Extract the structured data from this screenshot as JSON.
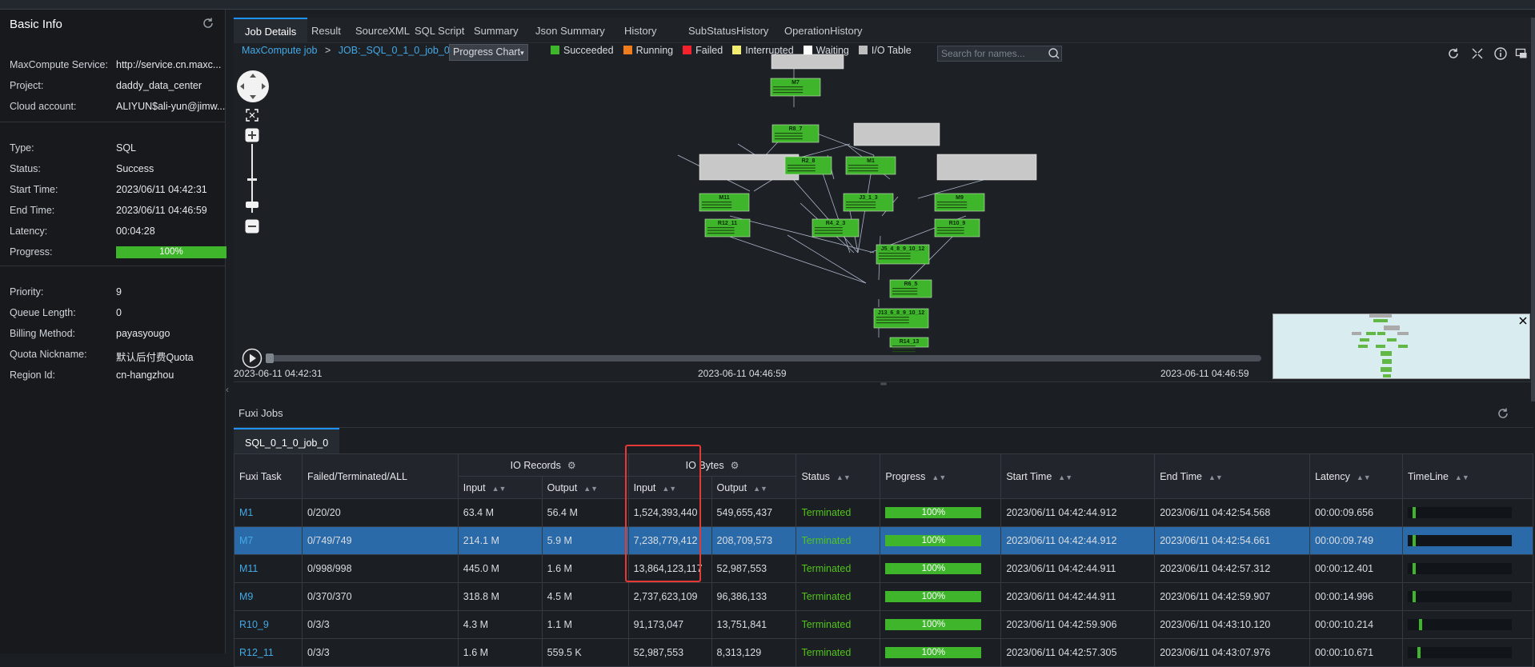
{
  "basic_info": {
    "title": "Basic Info",
    "fields": [
      {
        "label": "MaxCompute Service:",
        "value": "http://service.cn.maxc..."
      },
      {
        "label": "Project:",
        "value": "daddy_data_center"
      },
      {
        "label": "Cloud account:",
        "value": "ALIYUN$ali-yun@jimw..."
      },
      {
        "label": "Type:",
        "value": "SQL"
      },
      {
        "label": "Status:",
        "value": "Success"
      },
      {
        "label": "Start Time:",
        "value": "2023/06/11 04:42:31"
      },
      {
        "label": "End Time:",
        "value": "2023/06/11 04:46:59"
      },
      {
        "label": "Latency:",
        "value": "00:04:28"
      },
      {
        "label": "Progress:",
        "value": "100%"
      },
      {
        "label": "Priority:",
        "value": "9"
      },
      {
        "label": "Queue Length:",
        "value": "0"
      },
      {
        "label": "Billing Method:",
        "value": "payasyougo"
      },
      {
        "label": "Quota Nickname:",
        "value": "默认后付费Quota"
      },
      {
        "label": "Region Id:",
        "value": "cn-hangzhou"
      }
    ]
  },
  "tabs": [
    "Job Details",
    "Result",
    "SourceXML",
    "SQL Script",
    "Summary",
    "Json Summary",
    "History",
    "SubStatusHistory",
    "OperationHistory"
  ],
  "graph": {
    "breadcrumb": [
      "MaxCompute job",
      ">",
      "JOB:_SQL_0_1_0_job_0"
    ],
    "view_select": "Progress Chart",
    "legend": [
      {
        "label": "Succeeded",
        "color": "#3fb52c"
      },
      {
        "label": "Running",
        "color": "#f07c1e"
      },
      {
        "label": "Failed",
        "color": "#f5222d"
      },
      {
        "label": "Interrupted",
        "color": "#f2ee72"
      },
      {
        "label": "Waiting",
        "color": "#ffffff"
      },
      {
        "label": "I/O Table",
        "color": "#bdbdbd"
      }
    ],
    "search_placeholder": "Search for names...",
    "timeline": {
      "start": "2023-06-11 04:42:31",
      "mid": "2023-06-11 04:46:59",
      "end": "2023-06-11 04:46:59"
    },
    "nodes": [
      "M7",
      "R8_7",
      "R2_8",
      "M1",
      "M11",
      "J3_1_3",
      "M9",
      "R12_11",
      "R4_2_3",
      "R10_9",
      "J5_4_8_9_10_12",
      "R6_5",
      "J13_6_8_9_10_12",
      "R14_13"
    ]
  },
  "fuxi": {
    "title": "Fuxi Jobs",
    "job_tab": "SQL_0_1_0_job_0",
    "group_headers": {
      "io_records": "IO Records",
      "io_bytes": "IO Bytes"
    },
    "columns": {
      "task": "Fuxi Task",
      "ftl": "Failed/Terminated/ALL",
      "input": "Input",
      "output": "Output",
      "status": "Status",
      "progress": "Progress",
      "start": "Start Time",
      "end": "End Time",
      "latency": "Latency",
      "timeline": "TimeLine"
    },
    "rows": [
      {
        "task": "M1",
        "ftl": "0/20/20",
        "rec_in": "63.4 M",
        "rec_out": "56.4 M",
        "bytes_in": "1,524,393,440",
        "bytes_out": "549,655,437",
        "status": "Terminated",
        "progress": "100%",
        "start": "2023/06/11 04:42:44.912",
        "end": "2023/06/11 04:42:54.568",
        "latency": "00:00:09.656",
        "tl_start": 0.05,
        "tl_width": 0.03
      },
      {
        "task": "M7",
        "ftl": "0/749/749",
        "rec_in": "214.1 M",
        "rec_out": "5.9 M",
        "bytes_in": "7,238,779,412",
        "bytes_out": "208,709,573",
        "status": "Terminated",
        "progress": "100%",
        "start": "2023/06/11 04:42:44.912",
        "end": "2023/06/11 04:42:54.661",
        "latency": "00:00:09.749",
        "tl_start": 0.05,
        "tl_width": 0.03,
        "selected": true
      },
      {
        "task": "M11",
        "ftl": "0/998/998",
        "rec_in": "445.0 M",
        "rec_out": "1.6 M",
        "bytes_in": "13,864,123,117",
        "bytes_out": "52,987,553",
        "status": "Terminated",
        "progress": "100%",
        "start": "2023/06/11 04:42:44.911",
        "end": "2023/06/11 04:42:57.312",
        "latency": "00:00:12.401",
        "tl_start": 0.05,
        "tl_width": 0.03
      },
      {
        "task": "M9",
        "ftl": "0/370/370",
        "rec_in": "318.8 M",
        "rec_out": "4.5 M",
        "bytes_in": "2,737,623,109",
        "bytes_out": "96,386,133",
        "status": "Terminated",
        "progress": "100%",
        "start": "2023/06/11 04:42:44.911",
        "end": "2023/06/11 04:42:59.907",
        "latency": "00:00:14.996",
        "tl_start": 0.05,
        "tl_width": 0.03
      },
      {
        "task": "R10_9",
        "ftl": "0/3/3",
        "rec_in": "4.3 M",
        "rec_out": "1.1 M",
        "bytes_in": "91,173,047",
        "bytes_out": "13,751,841",
        "status": "Terminated",
        "progress": "100%",
        "start": "2023/06/11 04:42:59.906",
        "end": "2023/06/11 04:43:10.120",
        "latency": "00:00:10.214",
        "tl_start": 0.11,
        "tl_width": 0.03
      },
      {
        "task": "R12_11",
        "ftl": "0/3/3",
        "rec_in": "1.6 M",
        "rec_out": "559.5 K",
        "bytes_in": "52,987,553",
        "bytes_out": "8,313,129",
        "status": "Terminated",
        "progress": "100%",
        "start": "2023/06/11 04:42:57.305",
        "end": "2023/06/11 04:43:07.976",
        "latency": "00:00:10.671",
        "tl_start": 0.09,
        "tl_width": 0.03
      }
    ]
  }
}
